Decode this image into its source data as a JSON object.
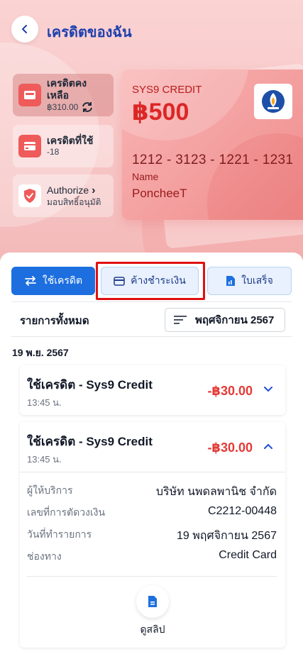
{
  "header": {
    "title": "เครดิตของฉัน"
  },
  "left_cards": [
    {
      "title": "เครดิตคงเหลือ",
      "value": "฿310.00"
    },
    {
      "title": "เครดิตที่ใช้",
      "value": "-18"
    },
    {
      "title": "Authorize",
      "subtitle": "มอบสิทธิ์อนุมัติ"
    }
  ],
  "credit_card": {
    "brand": "SYS9 CREDIT",
    "amount": "฿500",
    "number": "1212 - 3123 - 1221 - 1231",
    "name_label": "Name",
    "name": "PoncheeT"
  },
  "tabs": [
    {
      "label": "ใช้เครดิต",
      "active": true
    },
    {
      "label": "ค้างชำระเงิน",
      "active": false
    },
    {
      "label": "ใบเสร็จ",
      "active": false
    }
  ],
  "list": {
    "title": "รายการทั้งหมด",
    "month_filter": "พฤศจิกายน 2567",
    "date_header": "19 พ.ย. 2567"
  },
  "transactions": [
    {
      "title": "ใช้เครดิต - Sys9 Credit",
      "time": "13:45 น.",
      "amount": "-฿30.00",
      "expanded": false
    },
    {
      "title": "ใช้เครดิต - Sys9 Credit",
      "time": "13:45 น.",
      "amount": "-฿30.00",
      "expanded": true,
      "details": [
        {
          "key": "ผู้ให้บริการ",
          "value": "บริษัท นพดลพานิช จำกัด"
        },
        {
          "key": "เลขที่การตัดวงเงิน",
          "value": "C2212-00448"
        },
        {
          "key": "วันที่ทำรายการ",
          "value": "19 พฤศจิกายน 2567"
        },
        {
          "key": "ช่องทาง",
          "value": "Credit Card"
        }
      ],
      "slip_label": "ดูสลิป"
    }
  ],
  "colors": {
    "primary": "#1d6fe0",
    "danger": "#e53935",
    "highlight": "#e01010",
    "hero_bg": "#f7c6c6"
  }
}
